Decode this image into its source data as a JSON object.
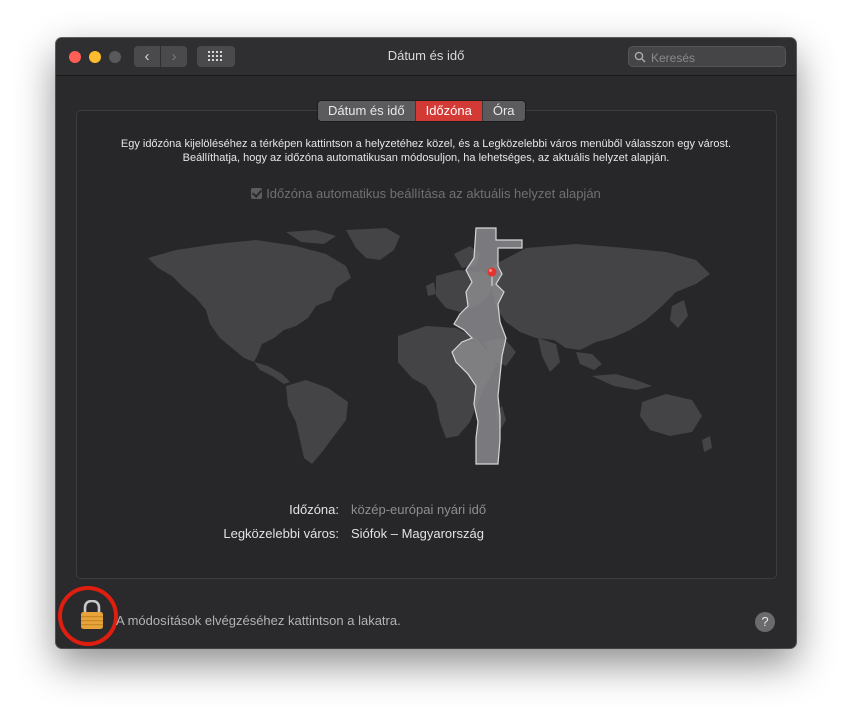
{
  "window": {
    "title": "Dátum és idő"
  },
  "toolbar": {
    "back_icon": "chevron-left-icon",
    "forward_icon": "chevron-right-icon",
    "grid_icon": "grid-icon",
    "search_placeholder": "Keresés"
  },
  "tabs": [
    {
      "label": "Dátum és idő",
      "active": false
    },
    {
      "label": "Időzóna",
      "active": true
    },
    {
      "label": "Óra",
      "active": false
    }
  ],
  "description": {
    "line1": "Egy időzóna kijelöléséhez a térképen kattintson a helyzetéhez közel, és a Legközelebbi város menüből válasszon egy várost.",
    "line2": "Beállíthatja, hogy az időzóna automatikusan módosuljon, ha lehetséges, az aktuális helyzet alapján."
  },
  "auto_checkbox": {
    "label": "Időzóna automatikus beállítása az aktuális helyzet alapján",
    "checked": true,
    "enabled": false
  },
  "info": {
    "timezone_label": "Időzóna:",
    "timezone_value": "közép-európai nyári idő",
    "city_label": "Legközelebbi város:",
    "city_value": "Siófok – Magyarország"
  },
  "footer": {
    "lock_message": "A módosítások elvégzéséhez kattintson a lakatra.",
    "help_label": "?"
  },
  "colors": {
    "accent": "#d33a35",
    "highlight_ring": "#e01e10",
    "lock": "#e8a43a"
  }
}
